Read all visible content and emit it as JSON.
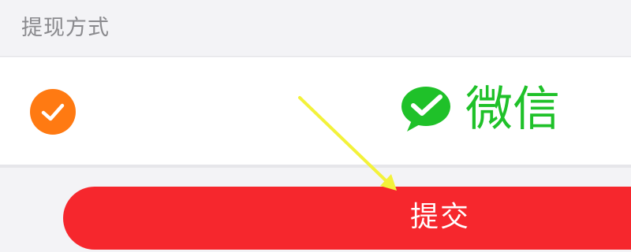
{
  "header": {
    "title": "提现方式"
  },
  "payment_method": {
    "selected": true,
    "label": "微信",
    "logo_icon": "wechat-icon",
    "check_icon": "check-icon"
  },
  "submit": {
    "label": "提交"
  },
  "colors": {
    "accent_orange": "#ff7a12",
    "wechat_green": "#1fc129",
    "submit_red": "#f6272d",
    "annotation_yellow": "#f3f23a"
  }
}
